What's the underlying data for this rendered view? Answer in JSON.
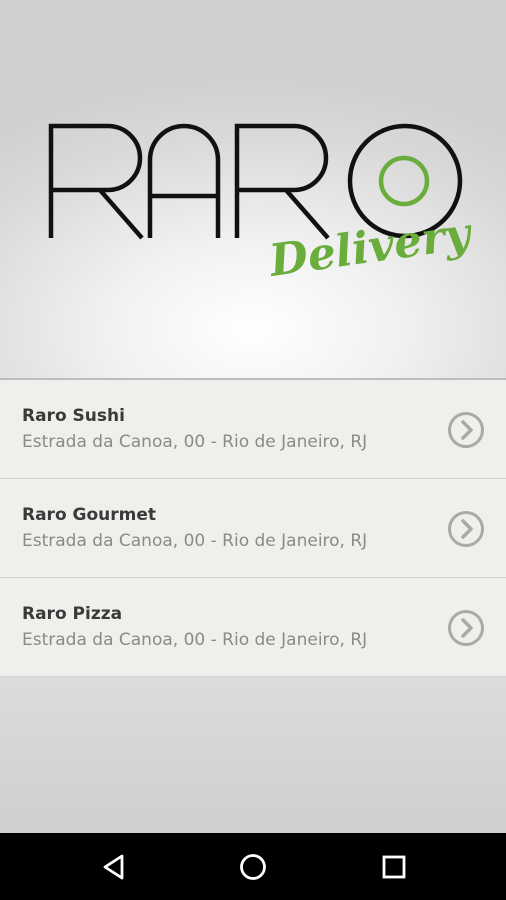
{
  "brand": {
    "logo_text": "RARO",
    "logo_subtext": "Delivery",
    "accent_color": "#6aad3d",
    "logo_color": "#111111"
  },
  "restaurants": [
    {
      "name": "Raro Sushi",
      "address": "Estrada da Canoa, 00 - Rio de Janeiro, RJ"
    },
    {
      "name": "Raro Gourmet",
      "address": "Estrada da Canoa, 00 - Rio de Janeiro, RJ"
    },
    {
      "name": "Raro Pizza",
      "address": "Estrada da Canoa, 00 - Rio de Janeiro, RJ"
    }
  ],
  "navbar": {
    "buttons": [
      "back-icon",
      "home-icon",
      "recents-icon"
    ]
  }
}
